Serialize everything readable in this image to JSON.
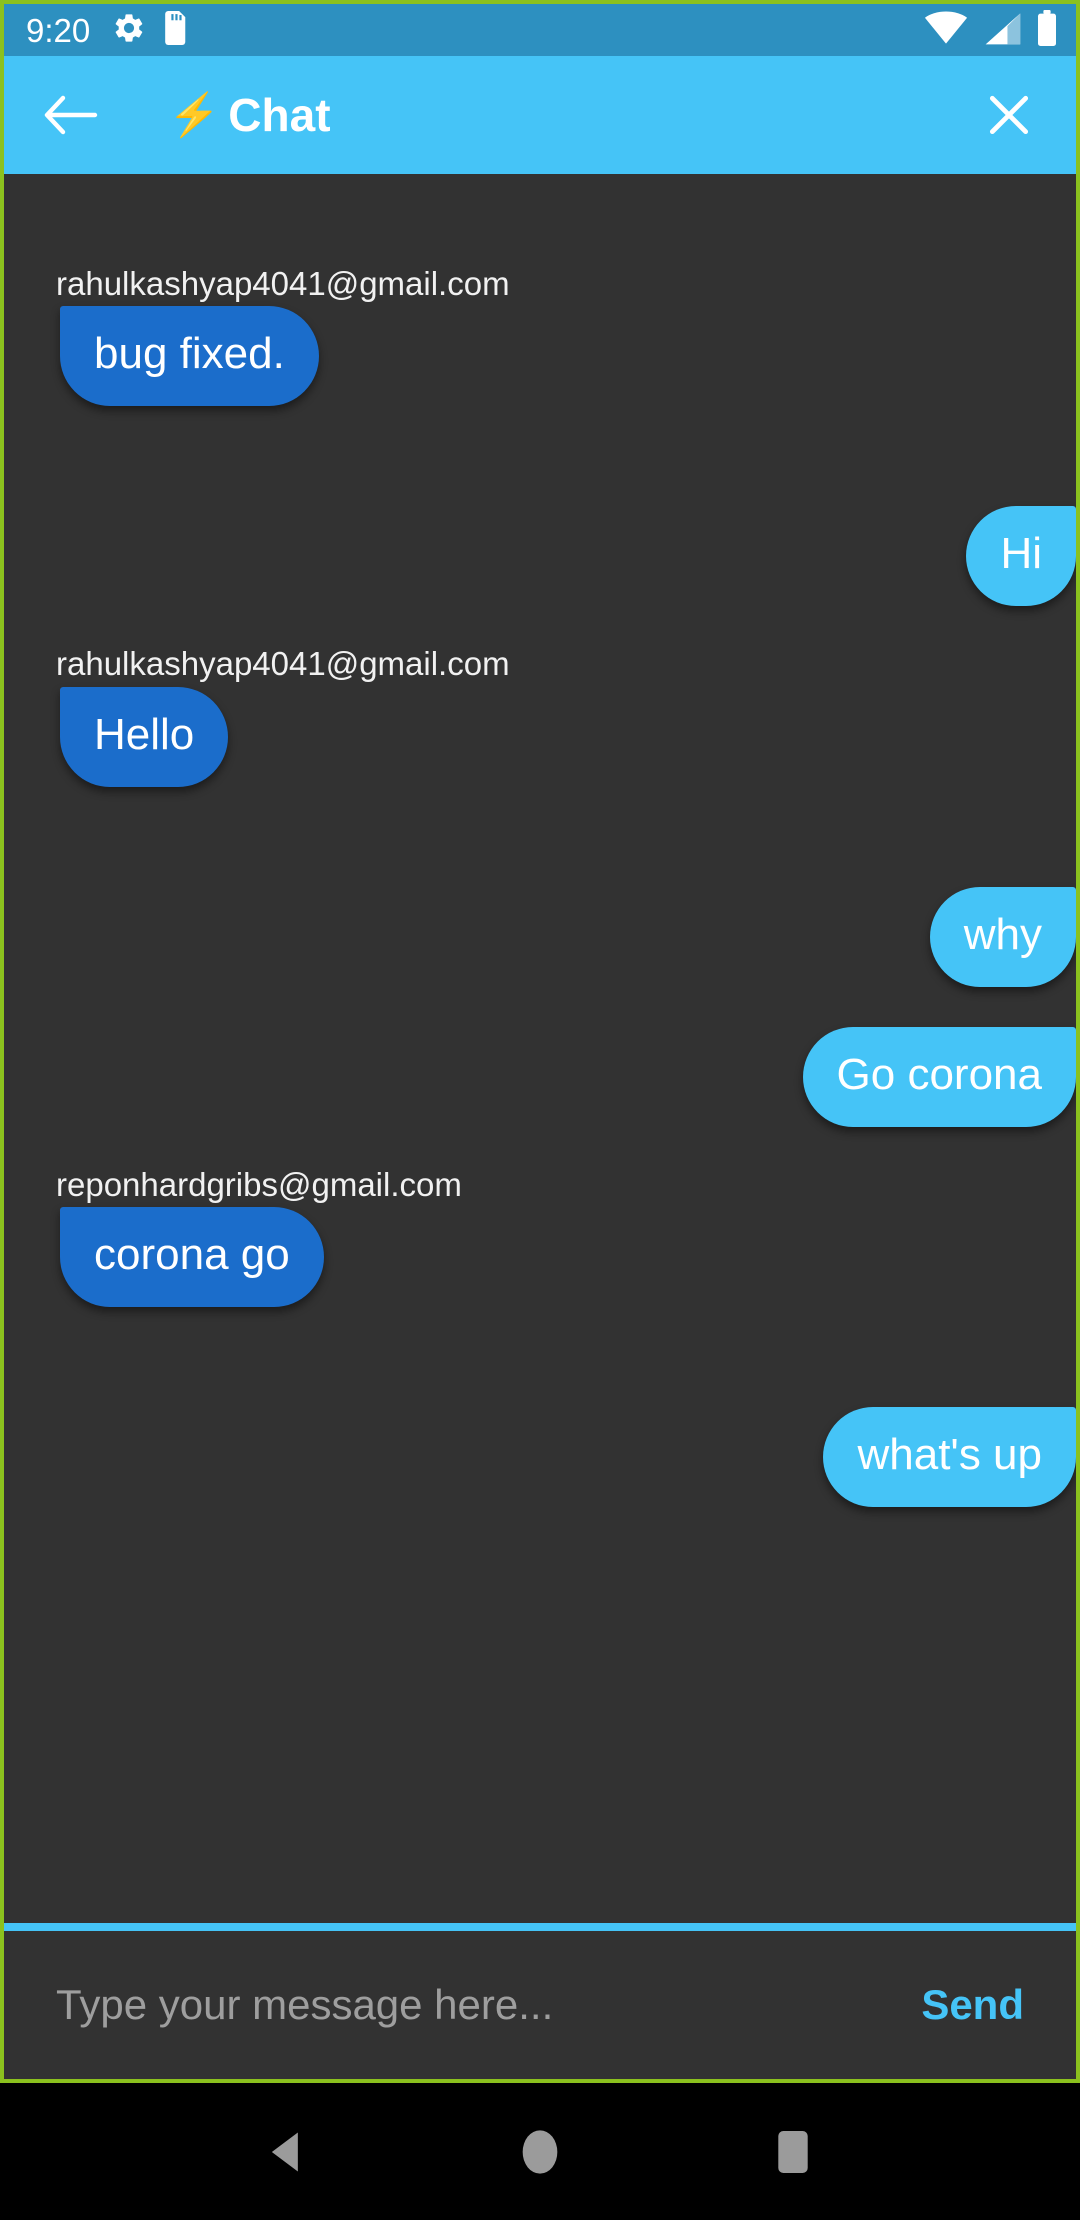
{
  "status_bar": {
    "time": "9:20",
    "icons": [
      "settings-gear-icon",
      "sd-card-icon",
      "wifi-icon",
      "cellular-signal-icon",
      "battery-icon"
    ],
    "background_color": "#2D90C0"
  },
  "header": {
    "back_icon": "back-arrow-icon",
    "bolt": "⚡",
    "title": "Chat",
    "close_icon": "close-x-icon",
    "background_color": "#45C4F7"
  },
  "theme": {
    "chat_background": "#323232",
    "incoming_bubble": "#1B6DCB",
    "outgoing_bubble": "#45C4F7",
    "accent": "#45C4F7",
    "frame_border": "#8BC11E"
  },
  "messages": [
    {
      "direction": "incoming",
      "sender": "rahulkashyap4041@gmail.com",
      "text": "bug fixed."
    },
    {
      "direction": "outgoing",
      "sender": "",
      "text": "Hi"
    },
    {
      "direction": "incoming",
      "sender": "rahulkashyap4041@gmail.com",
      "text": "Hello"
    },
    {
      "direction": "outgoing",
      "sender": "",
      "text": "why"
    },
    {
      "direction": "outgoing",
      "sender": "",
      "text": "Go corona"
    },
    {
      "direction": "incoming",
      "sender": "reponhardgribs@gmail.com",
      "text": "corona go"
    },
    {
      "direction": "outgoing",
      "sender": "",
      "text": "what's up"
    }
  ],
  "input_bar": {
    "placeholder": "Type your message here...",
    "value": "",
    "send_label": "Send"
  },
  "nav_bar": {
    "back_icon": "nav-back-triangle-icon",
    "home_icon": "nav-home-circle-icon",
    "recents_icon": "nav-recents-square-icon"
  }
}
